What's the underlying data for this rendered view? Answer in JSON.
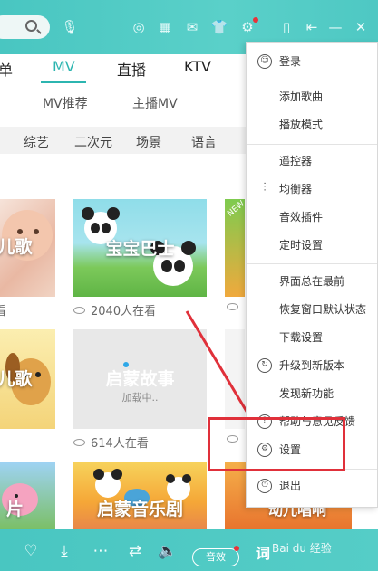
{
  "header": {
    "icons": [
      "search-icon",
      "mic-icon",
      "circle-icon",
      "grid-icon",
      "mail-icon",
      "shirt-icon",
      "gear-icon",
      "phone-icon",
      "back-icon",
      "minimize-icon",
      "close-icon"
    ]
  },
  "nav": {
    "tabs": [
      {
        "label": "单",
        "active": false
      },
      {
        "label": "MV",
        "active": true
      },
      {
        "label": "直播",
        "active": false
      },
      {
        "label": "KTV",
        "active": false
      }
    ],
    "subtabs": [
      "MV推荐",
      "主播MV"
    ]
  },
  "categories": [
    "综艺",
    "二次元",
    "场景",
    "语言"
  ],
  "tiles": [
    {
      "title": "儿歌",
      "viewers": "看"
    },
    {
      "title": "宝宝巴士",
      "viewers": "2040人在看",
      "badge": "NEW"
    },
    {
      "title": "",
      "viewers": ""
    },
    {
      "title": "儿歌",
      "viewers": ""
    },
    {
      "title": "启蒙故事",
      "loading": "加载中..",
      "viewers": "614人在看"
    },
    {
      "title": "片",
      "viewers": ""
    },
    {
      "title": "启蒙音乐剧",
      "viewers": ""
    },
    {
      "title": "动儿唱响",
      "viewers": ""
    }
  ],
  "menu": {
    "items": [
      {
        "label": "登录",
        "icon": "user-icon"
      },
      {
        "label": "添加歌曲",
        "icon": ""
      },
      {
        "label": "播放模式",
        "icon": ""
      },
      {
        "label": "遥控器",
        "icon": ""
      },
      {
        "label": "均衡器",
        "icon": "equalizer-icon"
      },
      {
        "label": "音效插件",
        "icon": ""
      },
      {
        "label": "定时设置",
        "icon": ""
      },
      {
        "label": "界面总在最前",
        "icon": ""
      },
      {
        "label": "恢复窗口默认状态",
        "icon": ""
      },
      {
        "label": "下载设置",
        "icon": ""
      },
      {
        "label": "升级到新版本",
        "icon": "upgrade-icon"
      },
      {
        "label": "发现新功能",
        "icon": ""
      },
      {
        "label": "帮助与意见反馈",
        "icon": "help-icon"
      },
      {
        "label": "设置",
        "icon": "gear-icon"
      },
      {
        "label": "退出",
        "icon": "power-icon"
      }
    ]
  },
  "player": {
    "sound_label": "音效",
    "lyrics_label": "词"
  },
  "watermark": "Bai du 经验",
  "colors": {
    "accent": "#2cb5b0",
    "header": "#4ec8c3",
    "highlight": "#e0303a"
  }
}
